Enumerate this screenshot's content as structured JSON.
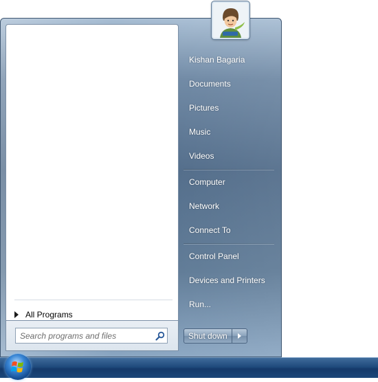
{
  "user": {
    "name": "Kishan Bagaria",
    "avatar": "user-avatar-icon"
  },
  "left_pane": {
    "all_programs_label": "All Programs",
    "search": {
      "value": "",
      "placeholder": "Search programs and files",
      "icon": "search-icon"
    }
  },
  "right_pane": {
    "group1": [
      "Kishan Bagaria",
      "Documents",
      "Pictures",
      "Music",
      "Videos"
    ],
    "group2": [
      "Computer",
      "Network",
      "Connect To"
    ],
    "group3": [
      "Control Panel",
      "Devices and Printers",
      "Run..."
    ]
  },
  "shutdown": {
    "label": "Shut down",
    "arrow_icon": "chevron-right-icon"
  },
  "taskbar": {
    "start_icon": "windows-logo-icon"
  },
  "colors": {
    "menu_glass": "#5d7995",
    "taskbar": "#1f4a7c",
    "text_light": "#ffffff"
  }
}
